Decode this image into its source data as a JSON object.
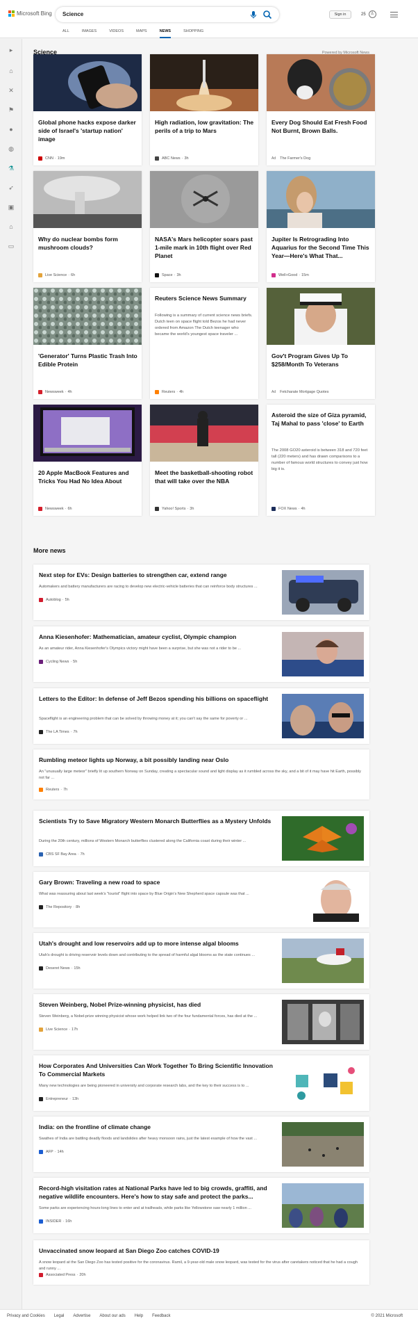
{
  "header": {
    "logo_text": "Microsoft Bing",
    "search_value": "Science",
    "sign_in": "Sign in",
    "rewards_count": "25",
    "tabs": [
      {
        "label": "ALL",
        "active": false
      },
      {
        "label": "IMAGES",
        "active": false
      },
      {
        "label": "VIDEOS",
        "active": false
      },
      {
        "label": "MAPS",
        "active": false
      },
      {
        "label": "NEWS",
        "active": true
      },
      {
        "label": "SHOPPING",
        "active": false
      }
    ],
    "colors": {
      "accent": "#0063b1",
      "ms_red": "#f25022",
      "ms_green": "#7fba00",
      "ms_blue": "#00a4ef",
      "ms_yellow": "#ffb900"
    }
  },
  "rail": {
    "icons": [
      "expand-arrow-icon",
      "home-icon",
      "tools-icon",
      "flag-icon",
      "location-pin-icon",
      "globe-icon",
      "science-microscope-icon",
      "rocket-icon",
      "entertainment-icon",
      "bank-icon",
      "money-icon"
    ]
  },
  "section": {
    "title": "Science",
    "powered_by": "Powered by Microsoft News"
  },
  "cards": [
    {
      "title": "Global phone hacks expose darker side of Israel's 'startup nation' image",
      "source": "CNN",
      "time": "19m",
      "ad": false
    },
    {
      "title": "High radiation, low gravitation: The perils of a trip to Mars",
      "source": "ABC News",
      "time": "3h",
      "ad": false
    },
    {
      "title": "Every Dog Should Eat Fresh Food Not Burnt, Brown Balls.",
      "source": "The Farmer's Dog",
      "time": "",
      "ad": true
    },
    {
      "title": "Why do nuclear bombs form mushroom clouds?",
      "source": "Live Science",
      "time": "6h",
      "ad": false
    },
    {
      "title": "NASA's Mars helicopter soars past 1-mile mark in 10th flight over Red Planet",
      "source": "Space",
      "time": "3h",
      "ad": false
    },
    {
      "title": "Jupiter Is Retrograding Into Aquarius for the Second Time This Year—Here's What That...",
      "source": "Well+Good",
      "time": "15m",
      "ad": false
    },
    {
      "title": "'Generator' Turns Plastic Trash Into Edible Protein",
      "source": "Newsweek",
      "time": "4h",
      "ad": false
    },
    {
      "title": "Reuters Science News Summary",
      "description": "Following is a summary of current science news briefs. Dutch teen on space flight told Bezos he had never ordered from Amazon The Dutch teenager who became the world's youngest space traveler ...",
      "source": "Reuters",
      "time": "4h",
      "ad": false
    },
    {
      "title": "Gov't Program Gives Up To $258/Month To Veterans",
      "source": "Fetcharate Mortgage Quotes",
      "time": "",
      "ad": true
    },
    {
      "title": "20 Apple MacBook Features and Tricks You Had No Idea About",
      "source": "Newsweek",
      "time": "6h",
      "ad": false
    },
    {
      "title": "Meet the basketball-shooting robot that will take over the NBA",
      "source": "Yahoo! Sports",
      "time": "3h",
      "ad": false
    },
    {
      "title": "Asteroid the size of Giza pyramid, Taj Mahal to pass 'close' to Earth",
      "description": "The 2008 GO20 asteroid is between 318 and 720 feet tall (220 meters) and has drawn comparisons to a number of famous world structures to convey just how big it is.",
      "source": "FOX News",
      "time": "4h",
      "ad": false
    }
  ],
  "ad_label": "Ad",
  "more_news": {
    "title": "More news",
    "items": [
      {
        "title": "Next step for EVs: Design batteries to strengthen car, extend range",
        "description": "Automakers and battery manufacturers are racing to develop new electric-vehicle batteries that can reinforce body structures ...",
        "source": "Autoblog",
        "time": "5h"
      },
      {
        "title": "Anna Kiesenhofer: Mathematician, amateur cyclist, Olympic champion",
        "description": "As an amateur rider, Anna Kiesenhofer's Olympics victory might have been a surprise, but she was not a rider to be ...",
        "source": "Cycling News",
        "time": "5h"
      },
      {
        "title": "Letters to the Editor: In defense of Jeff Bezos spending his billions on spaceflight",
        "description": "Spaceflight is an engineering problem that can be solved by throwing money at it; you can't say the same for poverty or ...",
        "source": "The LA Times",
        "time": "7h"
      },
      {
        "title": "Rumbling meteor lights up Norway, a bit possibly landing near Oslo",
        "description": "An \"unusually large meteor\" briefly lit up southern Norway on Sunday, creating a spectacular sound and light display as it rumbled across the sky, and a bit of it may have hit Earth, possibly not far ...",
        "source": "Reuters",
        "time": "7h"
      },
      {
        "title": "Scientists Try to Save Migratory Western Monarch Butterflies as a Mystery Unfolds",
        "description": "During the 20th century, millions of Western Monarch butterflies clustered along the California coast during their winter ...",
        "source": "CBS SF Bay Area",
        "time": "7h"
      },
      {
        "title": "Gary Brown: Traveling a new road to space",
        "description": "What was reassuring about last week's \"tourist\" flight into space by Blue Origin's New Shepherd space capsule was that ...",
        "source": "The Repository",
        "time": "8h"
      },
      {
        "title": "Utah's drought and low reservoirs add up to more intense algal blooms",
        "description": "Utah's drought is driving reservoir levels down and contributing to the spread of harmful algal blooms as the state continues ...",
        "source": "Deseret News",
        "time": "15h"
      },
      {
        "title": "Steven Weinberg, Nobel Prize-winning physicist, has died",
        "description": "Steven Weinberg, a Nobel-prize winning physicist whose work helped link two of the four fundamental forces, has died at the ...",
        "source": "Live Science",
        "time": "17h"
      },
      {
        "title": "How Corporates And Universities Can Work Together To Bring Scientific Innovation To Commercial Markets",
        "description": "Many new technologies are being pioneered in university and corporate research labs, and the key to their success is to ...",
        "source": "Entrepreneur",
        "time": "13h"
      },
      {
        "title": "India: on the frontline of climate change",
        "description": "Swathes of India are battling deadly floods and landslides after heavy monsoon rains, just the latest example of how the vast ...",
        "source": "AFP",
        "time": "14h"
      },
      {
        "title": "Record-high visitation rates at National Parks have led to big crowds, graffiti, and negative wildlife encounters. Here's how to stay safe and protect the parks...",
        "description": "Some parks are experiencing hours-long lines to enter and at trailheads, while parks like Yellowstone saw nearly 1 million ...",
        "source": "INSIDER",
        "time": "16h"
      },
      {
        "title": "Unvaccinated snow leopard at San Diego Zoo catches COVID-19",
        "description": "A snow leopard at the San Diego Zoo has tested positive for the coronavirus. Ramil, a 9-year-old male snow leopard, was tested for the virus after caretakers noticed that he had a cough and runny ...",
        "source": "Associated Press",
        "time": "20h"
      }
    ]
  },
  "footer": {
    "links": [
      "Privacy and Cookies",
      "Legal",
      "Advertise",
      "About our ads",
      "Help",
      "Feedback"
    ],
    "copyright": "© 2021 Microsoft"
  }
}
